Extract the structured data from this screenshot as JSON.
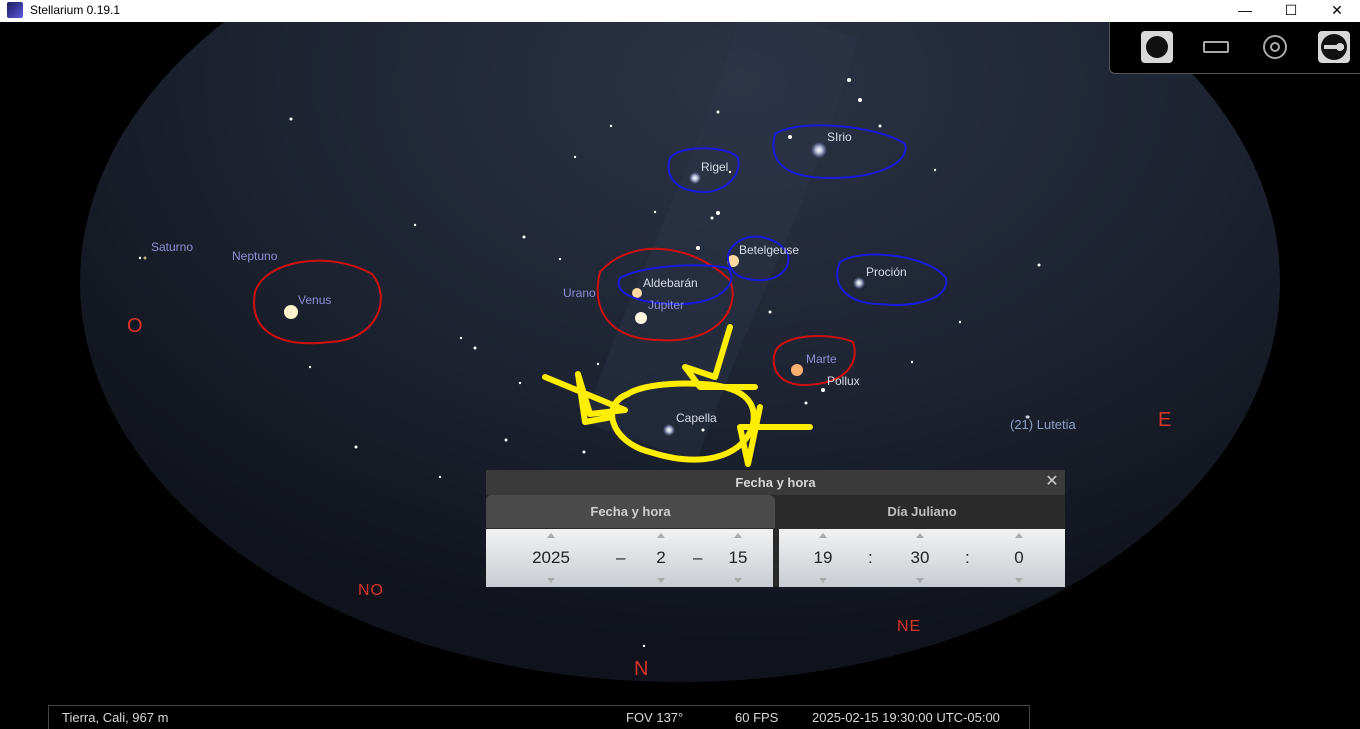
{
  "window": {
    "title": "Stellarium 0.19.1",
    "minimize_glyph": "—",
    "maximize_glyph": "☐",
    "close_glyph": "✕"
  },
  "sky": {
    "stars": [
      {
        "name": "Sirio"
      },
      {
        "name": "Rigel"
      },
      {
        "name": "Betelgeuse"
      },
      {
        "name": "Procyón"
      },
      {
        "name": "Aldebarán"
      },
      {
        "name": "Capella"
      },
      {
        "name": "Pollux"
      }
    ],
    "planets": [
      "Saturno",
      "Neptuno",
      "Venus",
      "Urano",
      "Júpiter",
      "Marte"
    ],
    "minor_body": "(21) Lutetia",
    "cardinals": {
      "O": "O",
      "E": "E",
      "NO": "NO",
      "NE": "NE",
      "N": "N"
    }
  },
  "star_labels": {
    "sirio": "SIrio",
    "rigel": "Rigel",
    "betelgeuse": "Betelgeuse",
    "procion": "Proción",
    "aldebaran": "Aldebarán",
    "capella": "Capella",
    "pollux": "Pollux"
  },
  "toolbar": {
    "icons": [
      "sky-icon",
      "landscape-icon",
      "atmosphere-icon",
      "cardinal-icon"
    ]
  },
  "dialog": {
    "title": "Fecha y hora",
    "close_glyph": "✕",
    "tabs": [
      {
        "label": "Fecha y hora",
        "active": true
      },
      {
        "label": "Día Juliano",
        "active": false
      }
    ],
    "date": {
      "year": "2025",
      "month": "2",
      "day": "15",
      "sep": "–"
    },
    "time": {
      "hour": "19",
      "minute": "30",
      "second": "0",
      "sep": ":"
    }
  },
  "status": {
    "location": "Tierra, Cali, 967 m",
    "fov": "FOV 137°",
    "fps": "60 FPS",
    "datetime": "2025-02-15 19:30:00 UTC-05:00"
  },
  "colors": {
    "red_annotation": "#d01010",
    "blue_annotation": "#1a1adf",
    "yellow_annotation": "#ffee00",
    "cardinal": "#d9342b"
  }
}
